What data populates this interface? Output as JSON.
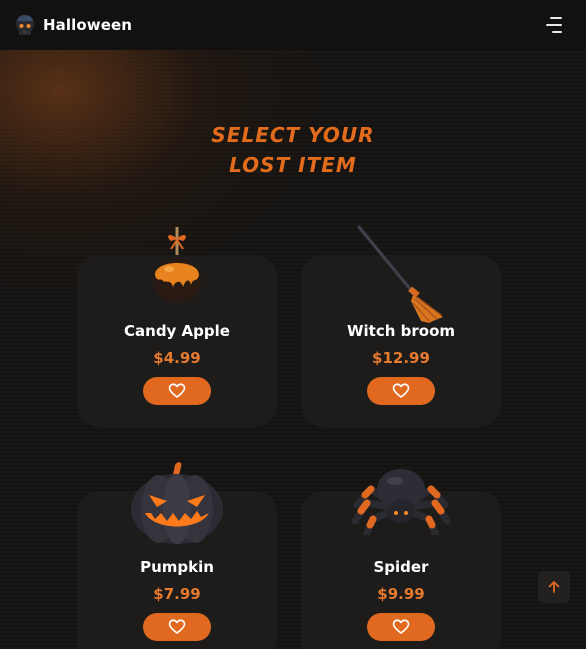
{
  "header": {
    "title": "Halloween",
    "logo_icon": "skull-icon",
    "menu_icon": "hamburger-menu-icon"
  },
  "section": {
    "title_line1": "SELECT YOUR",
    "title_line2": "LOST ITEM"
  },
  "products": [
    {
      "name": "Candy Apple",
      "price": "$4.99",
      "image_icon": "candy-apple-icon",
      "action_icon": "heart-icon"
    },
    {
      "name": "Witch broom",
      "price": "$12.99",
      "image_icon": "witch-broom-icon",
      "action_icon": "heart-icon"
    },
    {
      "name": "Pumpkin",
      "price": "$7.99",
      "image_icon": "pumpkin-icon",
      "action_icon": "heart-icon"
    },
    {
      "name": "Spider",
      "price": "$9.99",
      "image_icon": "spider-icon",
      "action_icon": "heart-icon"
    }
  ],
  "scroll_top_icon": "arrow-up-icon",
  "colors": {
    "accent": "#e0691f",
    "price": "#e67a2e",
    "title": "#e36b1c",
    "card": "#1e1c1b",
    "background": "#141210"
  }
}
